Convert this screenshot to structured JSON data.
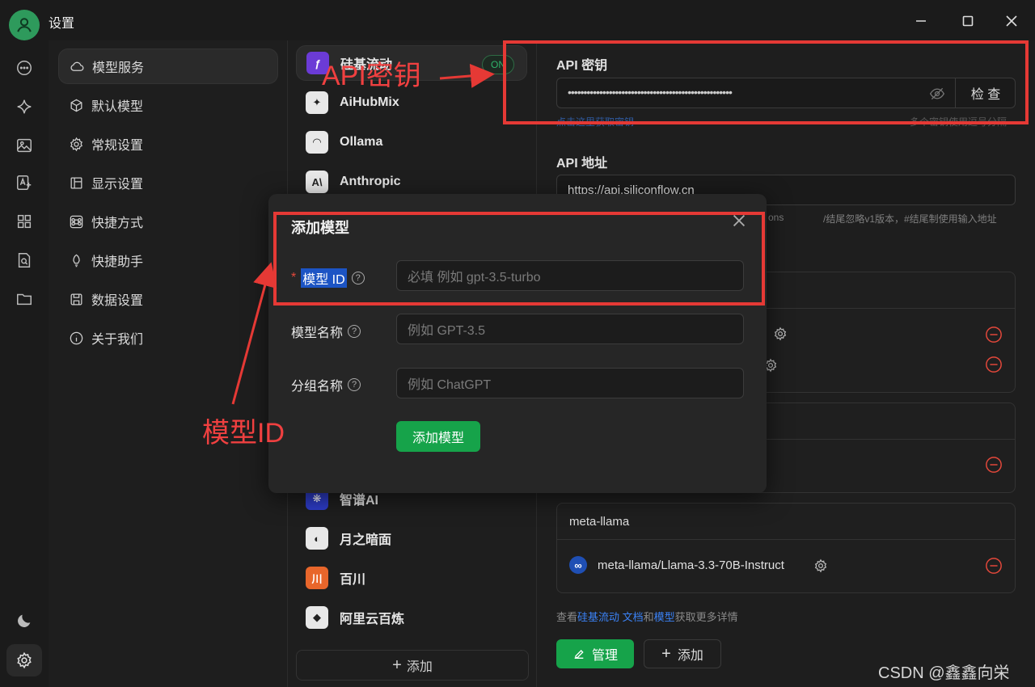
{
  "window": {
    "title": "设置"
  },
  "menu": {
    "items": [
      {
        "label": "模型服务",
        "icon": "cloud-icon"
      },
      {
        "label": "默认模型",
        "icon": "cube-icon"
      },
      {
        "label": "常规设置",
        "icon": "gear-icon"
      },
      {
        "label": "显示设置",
        "icon": "layout-icon"
      },
      {
        "label": "快捷方式",
        "icon": "command-icon"
      },
      {
        "label": "快捷助手",
        "icon": "rocket-icon"
      },
      {
        "label": "数据设置",
        "icon": "save-icon"
      },
      {
        "label": "关于我们",
        "icon": "info-icon"
      }
    ]
  },
  "providers": {
    "items": [
      {
        "label": "硅基流动",
        "color": "#6b3bd6",
        "glyph": "ƒ"
      },
      {
        "label": "AiHubMix",
        "color": "#e8e8e8",
        "glyph": "✦"
      },
      {
        "label": "Ollama",
        "color": "#e8e8e8",
        "glyph": "◠"
      },
      {
        "label": "Anthropic",
        "color": "#e8e8e8",
        "glyph": "A\\"
      },
      {
        "label": "智谱AI",
        "color": "#2d3cc7",
        "glyph": "❋"
      },
      {
        "label": "月之暗面",
        "color": "#e8e8e8",
        "glyph": "◐"
      },
      {
        "label": "百川",
        "color": "#e8662b",
        "glyph": "川"
      },
      {
        "label": "阿里云百炼",
        "color": "#e8e8e8",
        "glyph": "◆"
      }
    ],
    "on_badge": "ON",
    "add_label": "添加"
  },
  "api_key": {
    "title": "API 密钥",
    "value": "••••••••••••••••••••••••••••••••••••••••••••••••••••",
    "check_label": "检 查",
    "hint_left": "点击这里获取密钥",
    "hint_right": "多个密钥使用逗号分隔"
  },
  "api_url": {
    "title": "API 地址",
    "value": "https://api.siliconflow.cn",
    "hint_left": "ons",
    "hint_right": "/结尾忽略v1版本，#结尾制使用输入地址"
  },
  "groups": {
    "meta": {
      "name": "meta-llama",
      "model": "meta-llama/Llama-3.3-70B-Instruct"
    }
  },
  "footer": {
    "text_prefix": "查看",
    "link1": "硅基流动 文档",
    "text_mid": "和",
    "link2": "模型",
    "text_suffix": "获取更多详情",
    "manage_label": "管理",
    "add_label": "添加"
  },
  "modal": {
    "title": "添加模型",
    "required_mark": "*",
    "fields": [
      {
        "label": "模型 ID",
        "placeholder": "必填 例如 gpt-3.5-turbo"
      },
      {
        "label": "模型名称",
        "placeholder": "例如 GPT-3.5"
      },
      {
        "label": "分组名称",
        "placeholder": "例如 ChatGPT"
      }
    ],
    "submit_label": "添加模型",
    "help_glyph": "?"
  },
  "annotations": {
    "api_key_label": "API密钥",
    "model_id_label": "模型ID"
  },
  "watermark": "CSDN @鑫鑫向栄",
  "colors": {
    "accent_green": "#16a34a",
    "annotation_red": "#e53935",
    "link_blue": "#3b82f6"
  }
}
